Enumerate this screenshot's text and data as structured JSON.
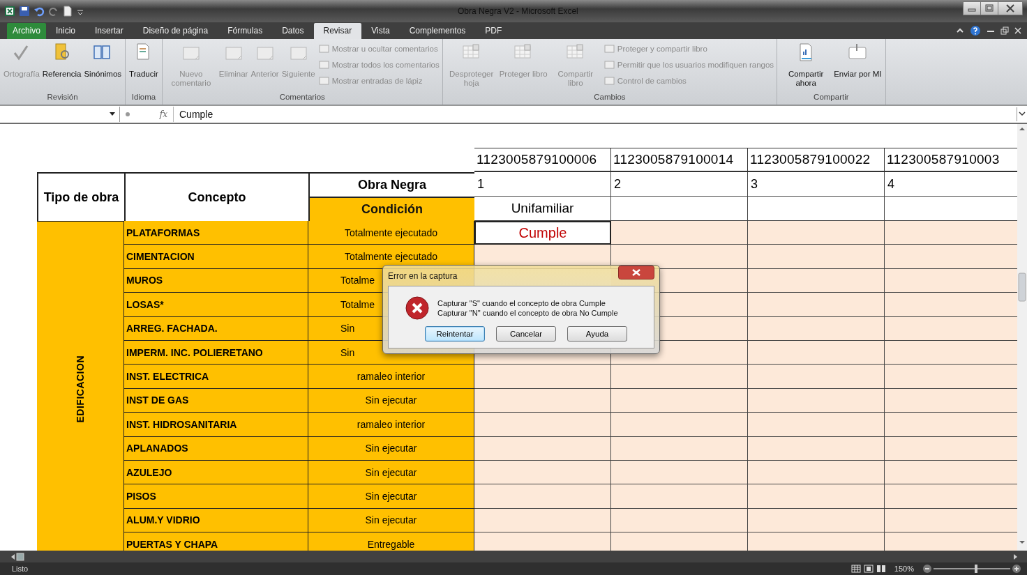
{
  "window": {
    "title": "Obra Negra V2  -  Microsoft Excel"
  },
  "tabs": [
    {
      "label": "Archivo",
      "kind": "file",
      "selected": false
    },
    {
      "label": "Inicio",
      "kind": "tab",
      "selected": false
    },
    {
      "label": "Insertar",
      "kind": "tab",
      "selected": false
    },
    {
      "label": "Diseño de página",
      "kind": "tab",
      "selected": false
    },
    {
      "label": "Fórmulas",
      "kind": "tab",
      "selected": false
    },
    {
      "label": "Datos",
      "kind": "tab",
      "selected": false
    },
    {
      "label": "Revisar",
      "kind": "tab",
      "selected": true
    },
    {
      "label": "Vista",
      "kind": "tab",
      "selected": false
    },
    {
      "label": "Complementos",
      "kind": "tab",
      "selected": false
    },
    {
      "label": "PDF",
      "kind": "tab",
      "selected": false
    }
  ],
  "ribbon": {
    "groups": [
      {
        "label": "Revisión",
        "items": [
          {
            "label": "Ortografía",
            "kind": "large",
            "disabled": true
          },
          {
            "label": "Referencia",
            "kind": "large",
            "disabled": false
          },
          {
            "label": "Sinónimos",
            "kind": "large",
            "disabled": false
          }
        ]
      },
      {
        "label": "Idioma",
        "items": [
          {
            "label": "Traducir",
            "kind": "large",
            "disabled": false
          }
        ]
      },
      {
        "label": "Comentarios",
        "items": [
          {
            "label": "Nuevo comentario",
            "kind": "large",
            "disabled": true
          },
          {
            "label": "Eliminar",
            "kind": "large",
            "disabled": true
          },
          {
            "label": "Anterior",
            "kind": "large",
            "disabled": true
          },
          {
            "label": "Siguiente",
            "kind": "large",
            "disabled": true
          },
          {
            "label": "Mostrar u ocultar comentarios",
            "kind": "small",
            "disabled": true
          },
          {
            "label": "Mostrar todos los comentarios",
            "kind": "small",
            "disabled": true
          },
          {
            "label": "Mostrar entradas de lápiz",
            "kind": "small",
            "disabled": true
          }
        ]
      },
      {
        "label": "Cambios",
        "items": [
          {
            "label": "Desproteger hoja",
            "kind": "large",
            "disabled": true
          },
          {
            "label": "Proteger libro",
            "kind": "large",
            "disabled": true
          },
          {
            "label": "Compartir libro",
            "kind": "large",
            "disabled": true
          },
          {
            "label": "Proteger y compartir libro",
            "kind": "small",
            "disabled": true
          },
          {
            "label": "Permitir que los usuarios modifiquen rangos",
            "kind": "small",
            "disabled": true
          },
          {
            "label": "Control de cambios",
            "kind": "small",
            "disabled": true
          }
        ]
      },
      {
        "label": "Compartir",
        "items": [
          {
            "label": "Compartir ahora",
            "kind": "large",
            "disabled": false
          },
          {
            "label": "Enviar por MI",
            "kind": "large",
            "disabled": false
          }
        ]
      }
    ]
  },
  "formula_bar": {
    "fx": "fx",
    "value": "Cumple"
  },
  "sheet": {
    "ids": [
      "1123005879100006",
      "1123005879100014",
      "1123005879100022",
      "112300587910003"
    ],
    "numbers": [
      "1",
      "2",
      "3",
      "4"
    ],
    "types": [
      "Unifamiliar"
    ],
    "header_tipo": "Tipo de obra",
    "header_concepto": "Concepto",
    "header_obra": "Obra Negra",
    "header_condicion": "Condición",
    "group": "EDIFICACION",
    "rows": [
      {
        "concept": "PLATAFORMAS",
        "condition": "Totalmente ejecutado",
        "cells": [
          "Cumple"
        ]
      },
      {
        "concept": "CIMENTACION",
        "condition": "Totalmente ejecutado"
      },
      {
        "concept": "MUROS",
        "condition": "Totalme",
        "covered": true
      },
      {
        "concept": "LOSAS*",
        "condition": "Totalme",
        "covered": true
      },
      {
        "concept": "ARREG. FACHADA.",
        "condition": "Sin",
        "covered": true
      },
      {
        "concept": "IMPERM. INC. POLIERETANO",
        "condition": "Sin",
        "covered": true
      },
      {
        "concept": "INST. ELECTRICA",
        "condition": "ramaleo interior"
      },
      {
        "concept": "INST DE GAS",
        "condition": "Sin ejecutar"
      },
      {
        "concept": "INST. HIDROSANITARIA",
        "condition": "ramaleo interior"
      },
      {
        "concept": "APLANADOS",
        "condition": "Sin ejecutar"
      },
      {
        "concept": "AZULEJO",
        "condition": "Sin ejecutar"
      },
      {
        "concept": "PISOS",
        "condition": "Sin ejecutar"
      },
      {
        "concept": "ALUM.Y VIDRIO",
        "condition": "Sin ejecutar"
      },
      {
        "concept": "PUERTAS Y CHAPA",
        "condition": "Entregable"
      }
    ]
  },
  "dialog": {
    "title": "Error en la captura",
    "lines": [
      "Capturar \"S\" cuando el concepto de obra Cumple",
      "Capturar \"N\" cuando el concepto de obra No Cumple"
    ],
    "buttons": [
      {
        "label": "Reintentar",
        "selected": true
      },
      {
        "label": "Cancelar",
        "selected": false
      },
      {
        "label": "Ayuda",
        "selected": false
      }
    ]
  },
  "status_bar": {
    "text": "Listo",
    "zoom": "150%",
    "level": 0.55
  }
}
